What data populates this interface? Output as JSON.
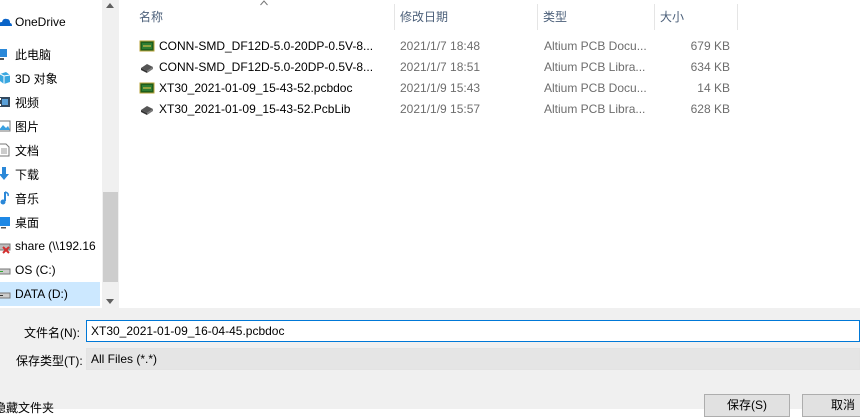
{
  "nav": {
    "items": [
      {
        "label": "OneDrive",
        "icon": "onedrive-icon"
      },
      {
        "label": "此电脑",
        "icon": "this-pc-icon"
      },
      {
        "label": "3D 对象",
        "icon": "3d-objects-icon"
      },
      {
        "label": "视频",
        "icon": "videos-icon"
      },
      {
        "label": "图片",
        "icon": "pictures-icon"
      },
      {
        "label": "文档",
        "icon": "documents-icon"
      },
      {
        "label": "下载",
        "icon": "downloads-icon"
      },
      {
        "label": "音乐",
        "icon": "music-icon"
      },
      {
        "label": "桌面",
        "icon": "desktop-icon"
      },
      {
        "label": "share (\\\\192.16",
        "icon": "network-drive-disconnected-icon"
      },
      {
        "label": "OS (C:)",
        "icon": "drive-icon"
      },
      {
        "label": "DATA (D:)",
        "icon": "drive-icon",
        "selected": true
      }
    ]
  },
  "columns": {
    "name": "名称",
    "date": "修改日期",
    "type": "类型",
    "size": "大小"
  },
  "files": [
    {
      "name": "CONN-SMD_DF12D-5.0-20DP-0.5V-8...",
      "date": "2021/1/7 18:48",
      "type": "Altium PCB Docu...",
      "size": "679 KB",
      "icon": "pcbdoc-icon"
    },
    {
      "name": "CONN-SMD_DF12D-5.0-20DP-0.5V-8...",
      "date": "2021/1/7 18:51",
      "type": "Altium PCB Libra...",
      "size": "634 KB",
      "icon": "pcblib-icon"
    },
    {
      "name": "XT30_2021-01-09_15-43-52.pcbdoc",
      "date": "2021/1/9 15:43",
      "type": "Altium PCB Docu...",
      "size": "14 KB",
      "icon": "pcbdoc-icon"
    },
    {
      "name": "XT30_2021-01-09_15-43-52.PcbLib",
      "date": "2021/1/9 15:57",
      "type": "Altium PCB Libra...",
      "size": "628 KB",
      "icon": "pcblib-icon"
    }
  ],
  "form": {
    "filename_label": "文件名(N):",
    "filename_value": "XT30_2021-01-09_16-04-45.pcbdoc",
    "filetype_label": "保存类型(T):",
    "filetype_value": "All Files (*.*)",
    "hide_folders": "隐藏文件夹",
    "save_button": "保存(S)",
    "cancel_button": "取消"
  }
}
